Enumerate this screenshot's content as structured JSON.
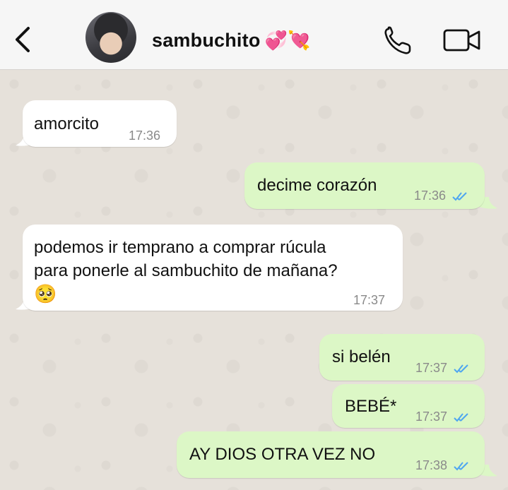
{
  "header": {
    "contact_name": "sambuchito",
    "contact_emoji": "💞💘"
  },
  "messages": [
    {
      "direction": "in",
      "text": "amorcito",
      "time": "17:36"
    },
    {
      "direction": "out",
      "text": "decime corazón",
      "time": "17:36",
      "status": "read"
    },
    {
      "direction": "in",
      "text_lines": [
        "podemos ir temprano a comprar rúcula",
        "para ponerle al sambuchito de mañana?"
      ],
      "emoji": "🥺",
      "time": "17:37"
    },
    {
      "direction": "out",
      "text": "si belén",
      "time": "17:37",
      "status": "read"
    },
    {
      "direction": "out",
      "text": "BEBÉ*",
      "time": "17:37",
      "status": "read"
    },
    {
      "direction": "out",
      "text": "AY DIOS OTRA VEZ NO",
      "time": "17:38",
      "status": "read"
    }
  ],
  "colors": {
    "incoming_bubble": "#ffffff",
    "outgoing_bubble": "#dcf7c6",
    "read_ticks": "#4fa6f0",
    "chat_background": "#e6e1da"
  }
}
